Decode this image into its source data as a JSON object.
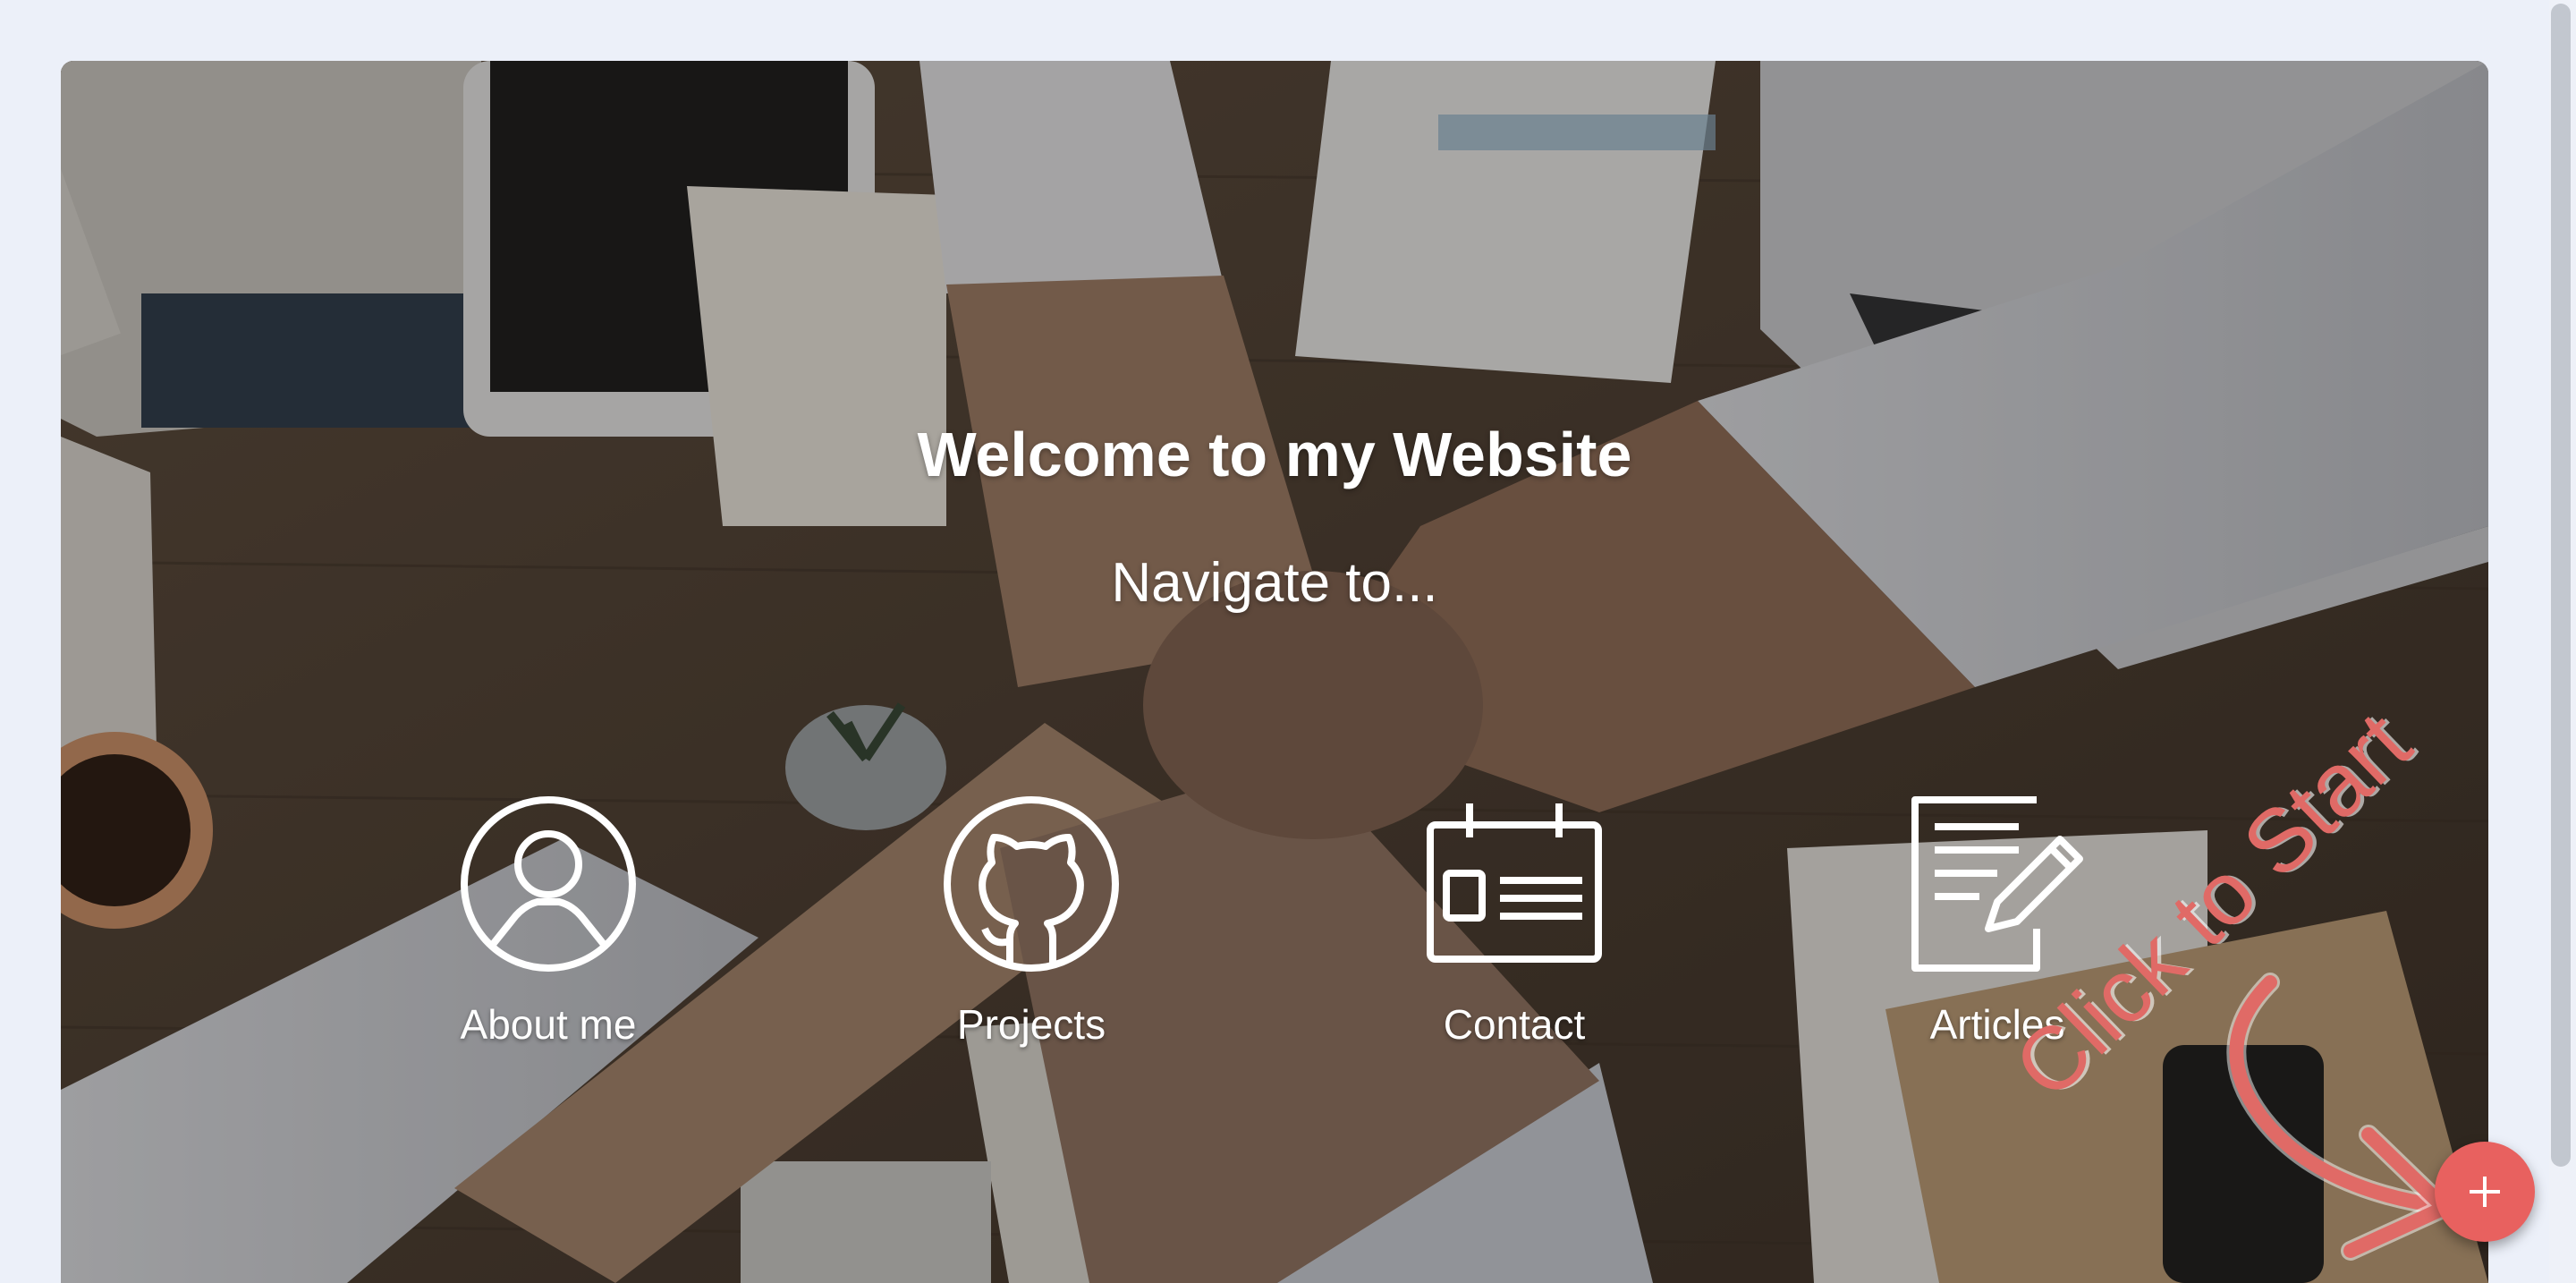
{
  "hero": {
    "title": "Welcome to my Website",
    "subtitle": "Navigate to..."
  },
  "nav": {
    "items": [
      {
        "label": "About me",
        "icon": "user-profile-icon"
      },
      {
        "label": "Projects",
        "icon": "github-icon"
      },
      {
        "label": "Contact",
        "icon": "contact-card-icon"
      },
      {
        "label": "Articles",
        "icon": "document-edit-icon"
      }
    ]
  },
  "start_hint": {
    "text": "Click to Start",
    "color": "#e06a66"
  },
  "fab": {
    "icon": "plus-icon",
    "color": "#e8615f"
  }
}
